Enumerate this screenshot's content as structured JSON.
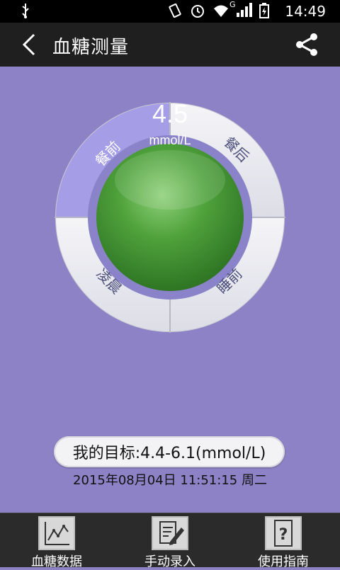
{
  "status_bar": {
    "time": "14:49",
    "net_label": "G"
  },
  "header": {
    "title": "血糖测量"
  },
  "meter": {
    "value": "4.5",
    "unit": "mmol/L",
    "segments": [
      "餐前",
      "餐后",
      "凌晨",
      "睡前"
    ],
    "selected_segment": "餐前"
  },
  "target": {
    "text": "我的目标:4.4-6.1(mmol/L)"
  },
  "timestamp": "2015年08月04日 11:51:15 周二",
  "tabs": [
    {
      "label": "血糖数据",
      "icon": "chart-icon"
    },
    {
      "label": "手动录入",
      "icon": "edit-icon"
    },
    {
      "label": "使用指南",
      "icon": "question-icon"
    }
  ],
  "colors": {
    "background": "#8e82c6",
    "selected_segment": "#a59de6",
    "segment": "#e9eaf0",
    "orb": "#4a9e37"
  }
}
